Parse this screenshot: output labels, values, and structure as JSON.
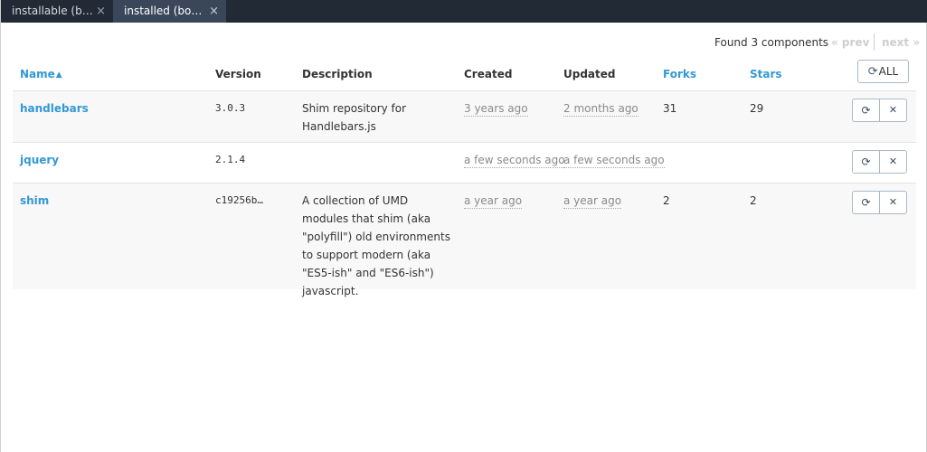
{
  "tabs": [
    {
      "label": "installable (b…",
      "close": "×"
    },
    {
      "label": "installed (bo…",
      "close": "×"
    }
  ],
  "pager": {
    "summary": "Found 3 components",
    "prev": "« prev",
    "next": "next »"
  },
  "table": {
    "headers": {
      "name": "Name",
      "version": "Version",
      "description": "Description",
      "created": "Created",
      "updated": "Updated",
      "forks": "Forks",
      "stars": "Stars"
    },
    "refresh_all_label": "ALL",
    "rows": [
      {
        "name": "handlebars",
        "version": "3.0.3",
        "description": "Shim repository for Handlebars.js",
        "created": "3 years ago",
        "updated": "2 months ago",
        "forks": "31",
        "stars": "29"
      },
      {
        "name": "jquery",
        "version": "2.1.4",
        "description": "",
        "created": "a few seconds ago",
        "updated": "a few seconds ago",
        "forks": "",
        "stars": ""
      },
      {
        "name": "shim",
        "version": "c19256b…",
        "description": "A collection of UMD modules that shim (aka \"polyfill\") old environments to support modern (aka \"ES5-ish\" and \"ES6-ish\") javascript.",
        "created": "a year ago",
        "updated": "a year ago",
        "forks": "2",
        "stars": "2"
      }
    ]
  },
  "icons": {
    "refresh": "refresh-icon",
    "remove": "close-icon",
    "sort": "sort-asc-icon"
  },
  "colors": {
    "tabbar_bg": "#222a36",
    "active_tab_bg": "#3a475a",
    "link": "#3398d6",
    "row_stripe": "#f8f8f8",
    "button_border": "#a9b8c8"
  }
}
